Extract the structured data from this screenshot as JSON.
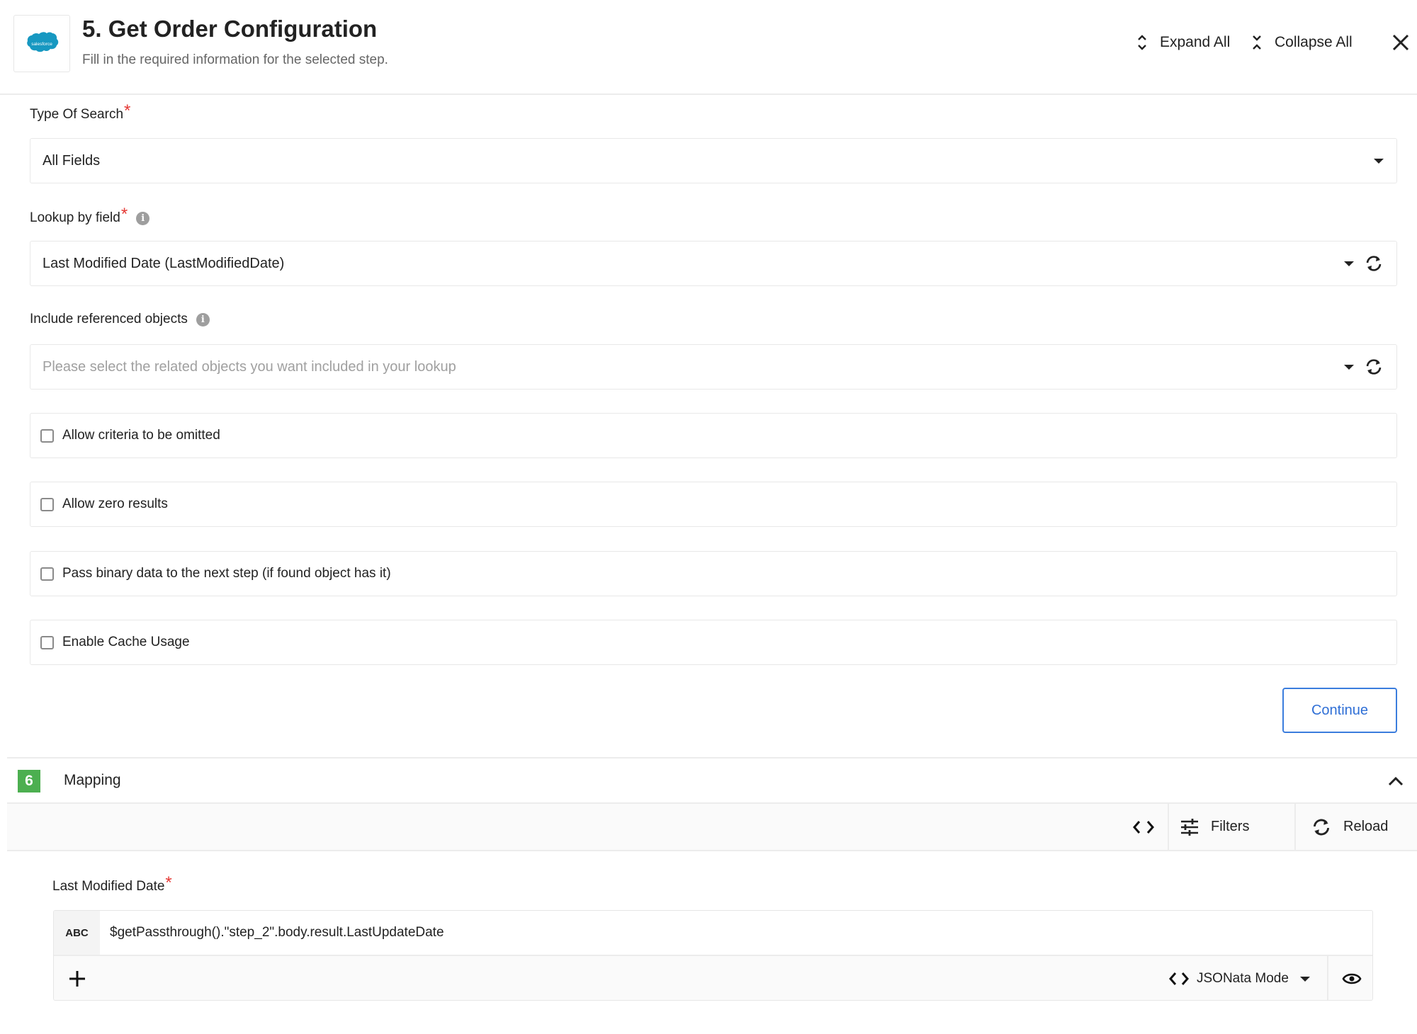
{
  "header": {
    "logo_text": "salesforce",
    "title": "5. Get Order Configuration",
    "subtitle": "Fill in the required information for the selected step.",
    "expand_all_label": "Expand All",
    "collapse_all_label": "Collapse All",
    "close_icon": "close-icon"
  },
  "form": {
    "type_of_search": {
      "label": "Type Of Search",
      "required_marker": "*",
      "value": "All Fields"
    },
    "lookup_by_field": {
      "label": "Lookup by field",
      "required_marker": "*",
      "info_glyph": "i",
      "value": "Last Modified Date (LastModifiedDate)"
    },
    "include_referenced_objects": {
      "label": "Include referenced objects",
      "info_glyph": "i",
      "placeholder": "Please select the related objects you want included in your lookup"
    },
    "checkboxes": [
      {
        "label": "Allow criteria to be omitted",
        "checked": false
      },
      {
        "label": "Allow zero results",
        "checked": false
      },
      {
        "label": "Pass binary data to the next step (if found object has it)",
        "checked": false
      },
      {
        "label": "Enable Cache Usage",
        "checked": false
      }
    ],
    "continue_label": "Continue"
  },
  "mapping": {
    "step_number": "6",
    "title": "Mapping",
    "toolbar": {
      "filters_label": "Filters",
      "reload_label": "Reload"
    },
    "field": {
      "label": "Last Modified Date",
      "required_marker": "*",
      "type_badge": "ABC",
      "expression": "$getPassthrough().\"step_2\".body.result.LastUpdateDate",
      "mode_label": "JSONata Mode"
    }
  },
  "colors": {
    "accent_blue": "#2f6fd6",
    "required_red": "#e53935",
    "step_badge_green": "#4caf50",
    "salesforce_blue": "#1798c1"
  }
}
